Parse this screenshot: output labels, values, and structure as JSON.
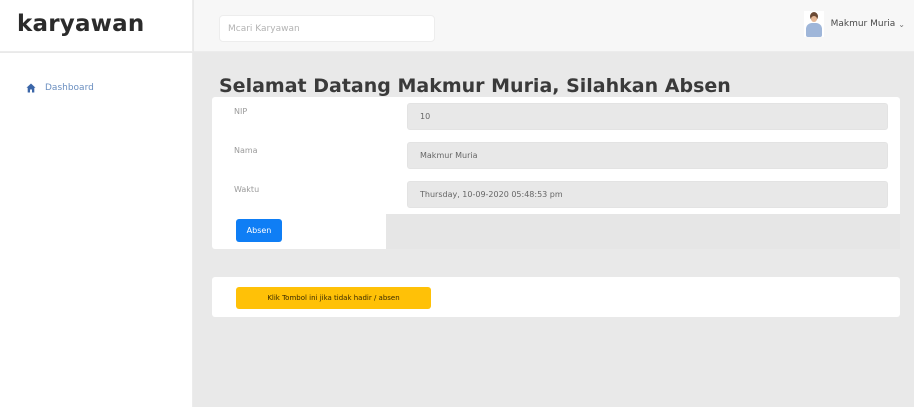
{
  "brand": {
    "name": "karyawan"
  },
  "topbar": {
    "search_placeholder": "Mcari Karyawan",
    "user_name": "Makmur Muria",
    "user_caret": "⌄"
  },
  "sidebar": {
    "items": [
      {
        "label": "Dashboard",
        "icon": "home-icon",
        "color": "#6b8fc0"
      }
    ]
  },
  "main": {
    "title": "Selamat Datang Makmur Muria, Silahkan Absen",
    "form": [
      {
        "label": "NIP",
        "value": "10"
      },
      {
        "label": "Nama",
        "value": "Makmur Muria"
      },
      {
        "label": "Waktu",
        "value": "Thursday, 10-09-2020 05:48:53 pm"
      }
    ],
    "absen_button": "Absen",
    "absen_button_color": "#0f7ef5",
    "warning_button": "Klik Tombol ini jika tidak hadir / absen",
    "warning_button_color": "#ffc107"
  }
}
